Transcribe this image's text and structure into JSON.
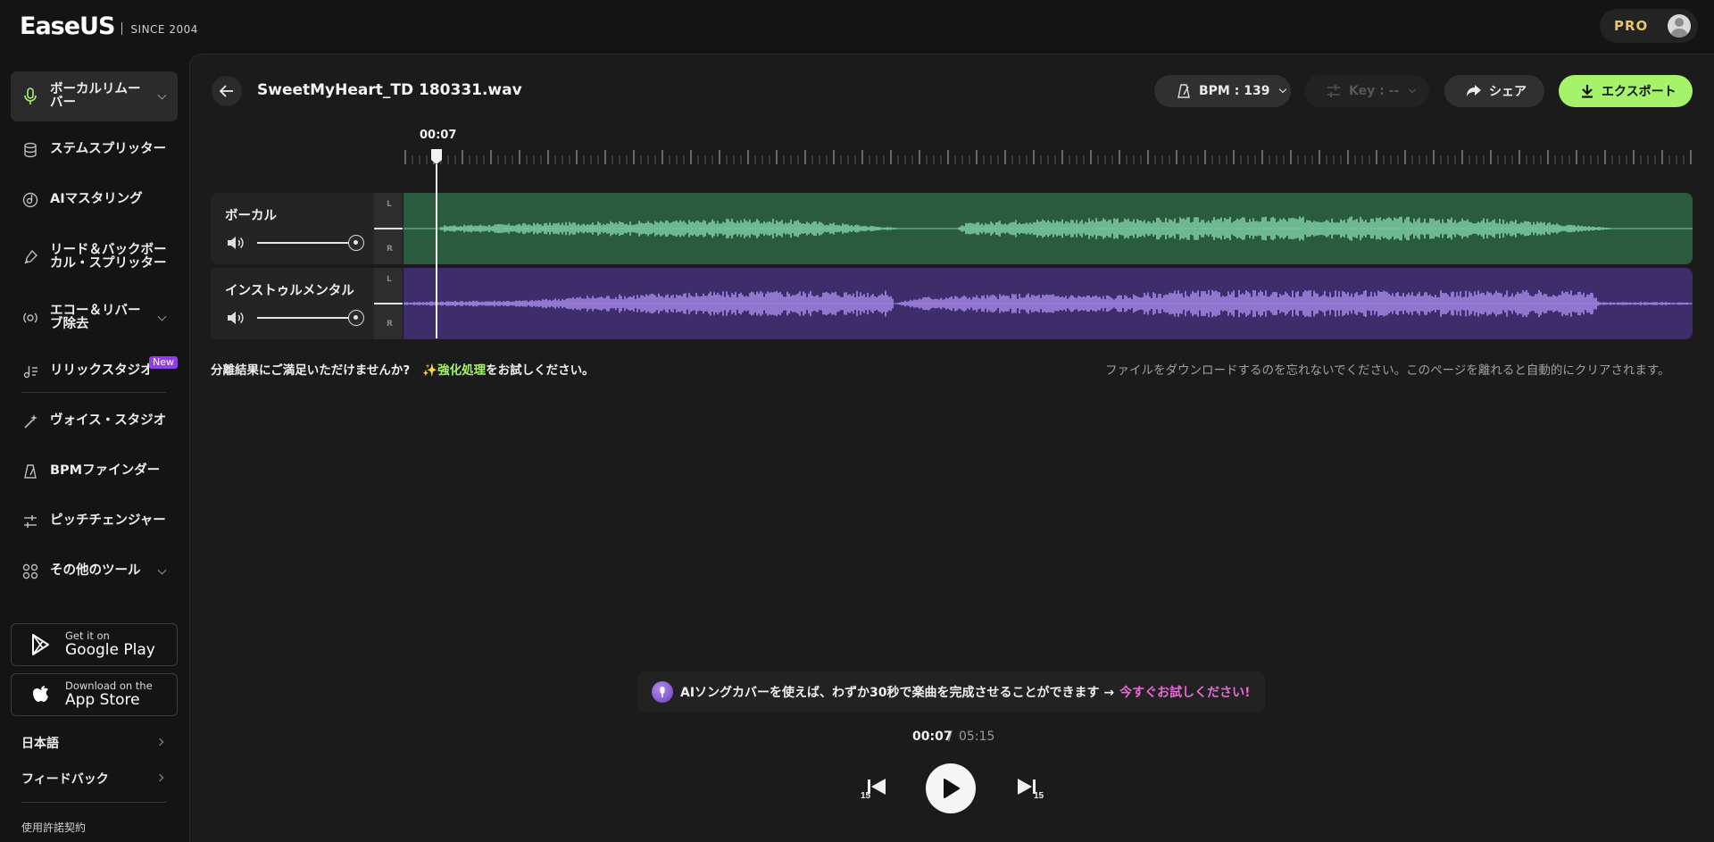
{
  "brand": {
    "logo_text": "EaseUS",
    "since": "SINCE 2004",
    "pro_label": "PRO"
  },
  "sidebar": {
    "items": [
      {
        "label": "ボーカルリムーバー",
        "icon": "microphone-icon",
        "active": true,
        "expandable": true
      },
      {
        "label": "ステムスプリッター",
        "icon": "stem-layers-icon"
      },
      {
        "label": "AIマスタリング",
        "icon": "mastering-disc-icon"
      },
      {
        "label": "リード＆バックボーカル・スプリッター",
        "icon": "split-brush-icon"
      },
      {
        "label": "エコー＆リバーブ除去",
        "icon": "echo-icon",
        "expandable": true
      },
      {
        "label": "リリックスタジオ",
        "icon": "lyrics-icon",
        "badge": "New"
      },
      {
        "label": "ヴォイス・スタジオ",
        "icon": "magic-wand-icon"
      },
      {
        "label": "BPMファインダー",
        "icon": "metronome-icon"
      },
      {
        "label": "ピッチチェンジャー",
        "icon": "pitch-sliders-icon"
      },
      {
        "label": "その他のツール",
        "icon": "grid-icon",
        "expandable": true
      }
    ],
    "stores": [
      {
        "small": "Get it on",
        "big": "Google Play",
        "icon": "google-play-icon"
      },
      {
        "small": "Download on the",
        "big": "App Store",
        "icon": "apple-icon"
      }
    ],
    "language": "日本語",
    "feedback": "フィードバック",
    "license": "使用許諾契約"
  },
  "editor": {
    "file_name": "SweetMyHeart_TD 180331.wav",
    "bpm_label": "BPM : 139",
    "key_label": "Key : --",
    "share_label": "シェア",
    "export_label": "エクスポート",
    "playhead_time": "00:07",
    "tracks": [
      {
        "name": "ボーカル",
        "volume": 1.0,
        "channel_l": "L",
        "channel_r": "R",
        "color": "#2a5b3f",
        "wave_color": "#7fd1a6"
      },
      {
        "name": "インストゥルメンタル",
        "volume": 1.0,
        "channel_l": "L",
        "channel_r": "R",
        "color": "#3e2d6b",
        "wave_color": "#a489e8"
      }
    ],
    "note_prefix": "分離結果にご満足いただけませんか?",
    "note_link": "✨強化処理",
    "note_suffix": "をお試しください。",
    "download_note": "ファイルをダウンロードするのを忘れないでください。このページを離れると自動的にクリアされます。"
  },
  "promo": {
    "text": "AIソングカバーを使えば、わずか30秒で楽曲を完成させることができます →",
    "link": "今すぐお試しください!"
  },
  "player": {
    "current": "00:07",
    "separator": "/",
    "total": "05:15",
    "rewind_label": "15",
    "forward_label": "15",
    "progress_fraction": 0.022
  },
  "colors": {
    "accent_green": "#a5f36a",
    "promo_pink": "#e76ad4",
    "new_badge": "#8e3fe6",
    "pro_gold": "#e7c36a"
  }
}
